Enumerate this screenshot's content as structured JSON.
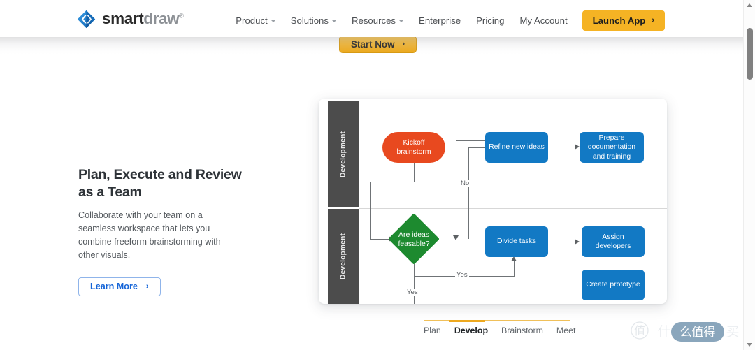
{
  "header": {
    "logo": {
      "icon": "smartdraw-diamond-logo-icon",
      "word_dark": "smart",
      "word_gray": "draw",
      "trademark": "®"
    },
    "nav_items": [
      {
        "label": "Product",
        "has_caret": true
      },
      {
        "label": "Solutions",
        "has_caret": true
      },
      {
        "label": "Resources",
        "has_caret": true
      },
      {
        "label": "Enterprise",
        "has_caret": false
      },
      {
        "label": "Pricing",
        "has_caret": false
      },
      {
        "label": "My Account",
        "has_caret": false
      }
    ],
    "launch_app": {
      "label": "Launch App",
      "chevron": "›",
      "color": "#f5b324"
    }
  },
  "hero": {
    "start_now": {
      "label": "Start Now",
      "chevron": "›",
      "color": "#eba81d"
    }
  },
  "feature": {
    "title": "Plan, Execute and Review as a Team",
    "body": "Collaborate with your team on a seamless workspace that lets you combine freeform brainstorming with other visuals.",
    "learn_more": {
      "label": "Learn More",
      "chevron": "›",
      "color": "#1565d8"
    }
  },
  "diagram": {
    "type": "flowchart",
    "lanes": [
      {
        "label": "Development"
      },
      {
        "label": "Development"
      }
    ],
    "nodes": [
      {
        "id": "kickoff",
        "label": "Kickoff brainstorm",
        "shape": "rounded-pill",
        "color": "#e8491f",
        "lane": 0
      },
      {
        "id": "refine",
        "label": "Refine new ideas",
        "shape": "rectangle",
        "color": "#1279c4",
        "lane": 0
      },
      {
        "id": "prepare",
        "label": "Prepare documentation and training",
        "shape": "rectangle",
        "color": "#1279c4",
        "lane": 0
      },
      {
        "id": "feasable",
        "label": "Are ideas feasable?",
        "shape": "diamond",
        "color": "#1d8a2f",
        "lane": 1
      },
      {
        "id": "divide",
        "label": "Divide tasks",
        "shape": "rectangle",
        "color": "#1279c4",
        "lane": 1
      },
      {
        "id": "assign",
        "label": "Assign developers",
        "shape": "rectangle",
        "color": "#1279c4",
        "lane": 1
      },
      {
        "id": "prototype",
        "label": "Create prototype",
        "shape": "rectangle",
        "color": "#1279c4",
        "lane": 1
      }
    ],
    "edge_labels": [
      {
        "id": "no",
        "label": "No"
      },
      {
        "id": "yes-right",
        "label": "Yes"
      },
      {
        "id": "yes-down",
        "label": "Yes"
      }
    ]
  },
  "tabs": {
    "items": [
      {
        "label": "Plan",
        "active": false
      },
      {
        "label": "Develop",
        "active": true
      },
      {
        "label": "Brainstorm",
        "active": false
      },
      {
        "label": "Meet",
        "active": false
      }
    ],
    "accent_color": "#eea91f"
  },
  "watermark": {
    "text": "什么值得买",
    "badge_text": "值"
  },
  "scrollbar": {
    "up_arrow": "▲",
    "down_arrow": "▼"
  }
}
